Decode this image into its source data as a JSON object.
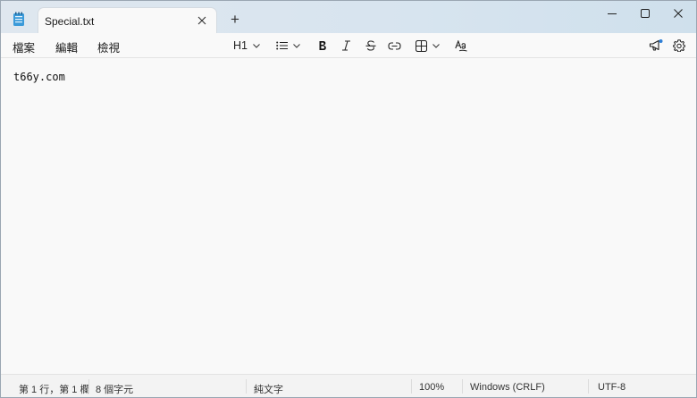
{
  "tab": {
    "title": "Special.txt",
    "close_icon": "close-icon",
    "new_tab_label": "+"
  },
  "window_controls": {
    "minimize_icon": "minimize-icon",
    "maximize_icon": "maximize-icon",
    "close_icon": "close-icon"
  },
  "menu": {
    "file": "檔案",
    "edit": "編輯",
    "view": "檢視"
  },
  "toolbar": {
    "heading": "H1",
    "list_icon": "bulleted-list-icon",
    "bold_icon": "bold-icon",
    "italic_icon": "italic-icon",
    "strikethrough_icon": "strikethrough-icon",
    "link_icon": "link-icon",
    "table_icon": "table-icon",
    "spellcheck_icon": "spellcheck-icon",
    "copilot_icon": "megaphone-icon",
    "settings_icon": "gear-icon"
  },
  "editor": {
    "content": "t66y.com"
  },
  "status": {
    "position": "第 1 行，第 1 欄",
    "char_count": "8 個字元",
    "format": "純文字",
    "zoom": "100%",
    "line_ending": "Windows (CRLF)",
    "encoding": "UTF-8"
  },
  "colors": {
    "titlebar": "#d7e4ef",
    "background": "#f9f9f9",
    "notification_dot": "#2f7fd6"
  }
}
